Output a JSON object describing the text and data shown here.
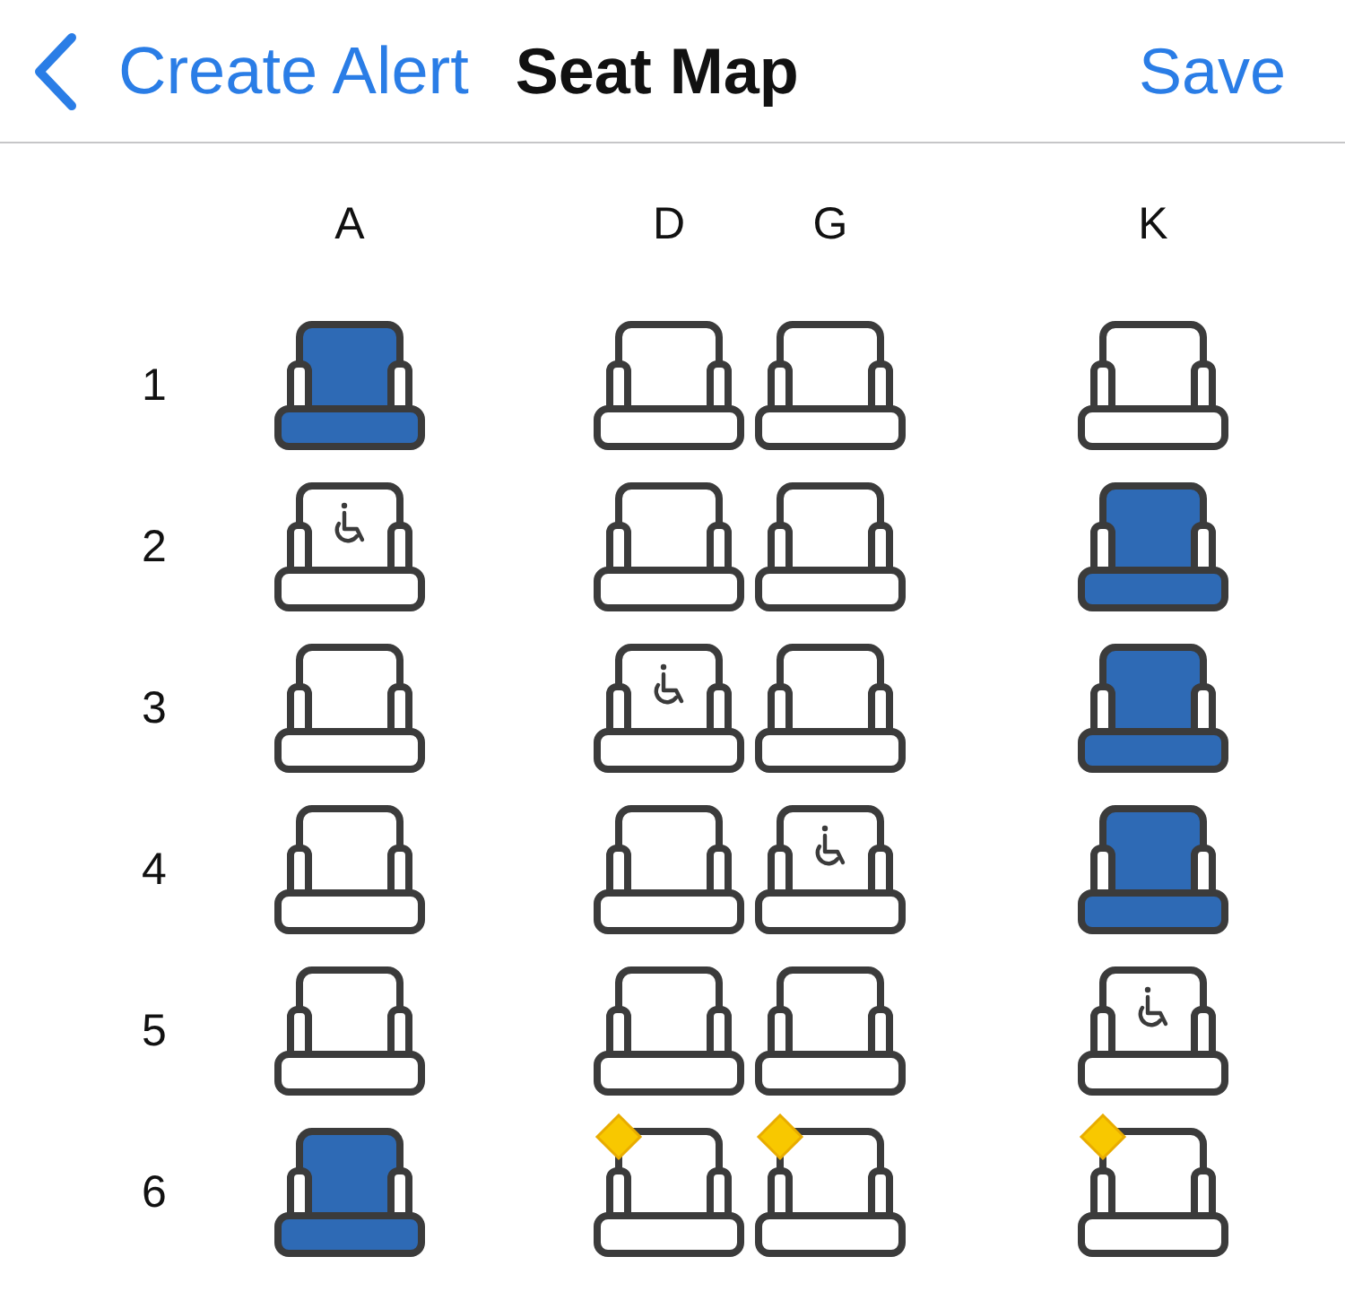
{
  "nav_bar": {
    "back_label": "Create Alert",
    "title": "Seat Map",
    "action": "Save"
  },
  "seat_map": {
    "columns": [
      "A",
      "D",
      "G",
      "K"
    ],
    "rows": [
      {
        "number": "1",
        "seats": [
          {
            "kind": "filled"
          },
          {
            "kind": "open"
          },
          {
            "kind": "open"
          },
          {
            "kind": "open"
          }
        ]
      },
      {
        "number": "2",
        "seats": [
          {
            "kind": "accessible"
          },
          {
            "kind": "open"
          },
          {
            "kind": "open"
          },
          {
            "kind": "filled"
          }
        ]
      },
      {
        "number": "3",
        "seats": [
          {
            "kind": "open"
          },
          {
            "kind": "accessible"
          },
          {
            "kind": "open"
          },
          {
            "kind": "filled"
          }
        ]
      },
      {
        "number": "4",
        "seats": [
          {
            "kind": "open"
          },
          {
            "kind": "open"
          },
          {
            "kind": "accessible"
          },
          {
            "kind": "filled"
          }
        ]
      },
      {
        "number": "5",
        "seats": [
          {
            "kind": "open"
          },
          {
            "kind": "open"
          },
          {
            "kind": "open"
          },
          {
            "kind": "accessible"
          }
        ]
      },
      {
        "number": "6",
        "seats": [
          {
            "kind": "filled"
          },
          {
            "kind": "marked"
          },
          {
            "kind": "marked"
          },
          {
            "kind": "marked"
          }
        ]
      }
    ]
  }
}
